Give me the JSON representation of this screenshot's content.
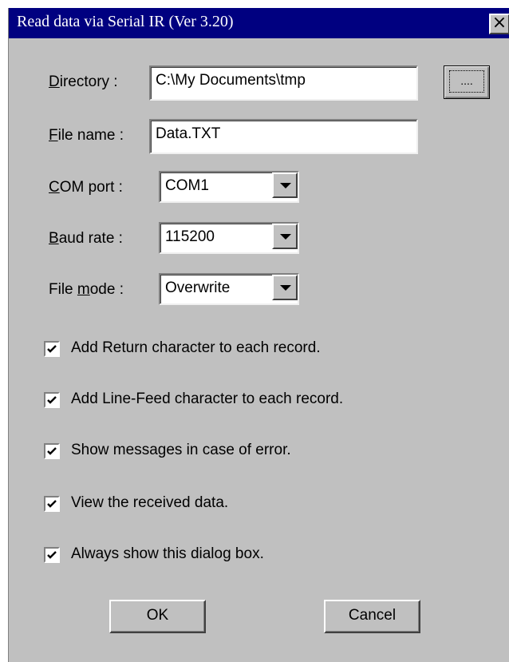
{
  "window": {
    "title": "Read data via Serial IR (Ver 3.20)",
    "close_label": "×"
  },
  "form": {
    "directory": {
      "label_prefix": "",
      "label_accel": "D",
      "label_rest": "irectory :",
      "value": "C:\\My Documents\\tmp"
    },
    "browse_label": "....",
    "file_name": {
      "label_prefix": "",
      "label_accel": "F",
      "label_rest": "ile name :",
      "value": "Data.TXT"
    },
    "com_port": {
      "label_prefix": "",
      "label_accel": "C",
      "label_rest": "OM port :",
      "value": "COM1"
    },
    "baud_rate": {
      "label_prefix": "",
      "label_accel": "B",
      "label_rest": "aud rate :",
      "value": "115200"
    },
    "file_mode": {
      "label_prefix": "File ",
      "label_accel": "m",
      "label_rest": "ode :",
      "value": "Overwrite"
    }
  },
  "options": [
    {
      "label": "Add Return character to each record.",
      "checked": true
    },
    {
      "label": "Add Line-Feed character to each record.",
      "checked": true
    },
    {
      "label": "Show messages in case of error.",
      "checked": true
    },
    {
      "label": "View the received data.",
      "checked": true
    },
    {
      "label": "Always show this dialog box.",
      "checked": true
    }
  ],
  "buttons": {
    "ok": "OK",
    "cancel": "Cancel"
  }
}
